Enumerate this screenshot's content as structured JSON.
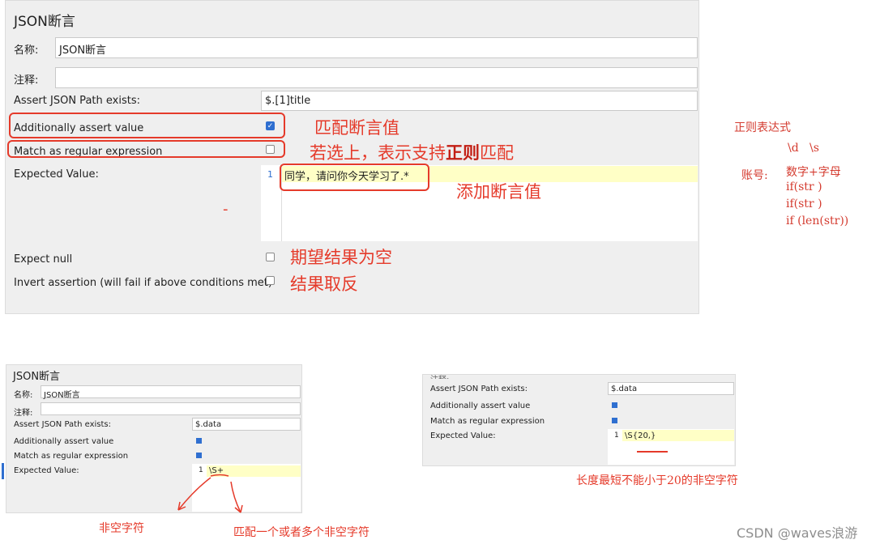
{
  "top": {
    "title": "JSON断言",
    "name_label": "名称:",
    "name_value": "JSON断言",
    "comment_label": "注释:",
    "comment_value": "",
    "path_label": "Assert JSON Path exists:",
    "path_value": "$.[1]title",
    "additionally_label": "Additionally assert value",
    "additionally_checked": true,
    "regex_label": "Match as regular expression",
    "regex_checked": false,
    "expected_label": "Expected Value:",
    "line_no": "1",
    "expected_value": "同学，请问你今天学习了.*",
    "expect_null_label": "Expect null",
    "invert_label": "Invert assertion (will fail if above conditions met)"
  },
  "annotations": {
    "match_assert": "匹配断言值",
    "regex_support_pre": "若选上，表示支持",
    "regex_support_bold": "正则",
    "regex_support_post": "匹配",
    "add_value": "添加断言值",
    "expect_empty": "期望结果为空",
    "invert_result": "结果取反",
    "dash": "-"
  },
  "notes": {
    "title": "正则表达式",
    "line1": "\\d   \\s",
    "account": "账号:",
    "line2": "数字+字母",
    "line3": "if(str )",
    "line4": "if(str )",
    "line5": "if (len(str))"
  },
  "bottom_left": {
    "title": "JSON断言",
    "name_label": "名称:",
    "name_value": "JSON断言",
    "comment_label": "注释:",
    "path_label": "Assert JSON Path exists:",
    "path_value": "$.data",
    "additionally_label": "Additionally assert value",
    "regex_label": "Match as regular expression",
    "expected_label": "Expected Value:",
    "line_no": "1",
    "expected_value": "\\S+",
    "caption_left": "非空字符",
    "caption_right": "匹配一个或者多个非空字符"
  },
  "bottom_right": {
    "comment_label": "注释:",
    "path_label": "Assert JSON Path exists:",
    "path_value": "$.data",
    "additionally_label": "Additionally assert value",
    "regex_label": "Match as regular expression",
    "expected_label": "Expected Value:",
    "line_no": "1",
    "expected_value": "\\S{20,}",
    "caption": "长度最短不能小于20的非空字符"
  },
  "watermark": "CSDN @waves浪游"
}
